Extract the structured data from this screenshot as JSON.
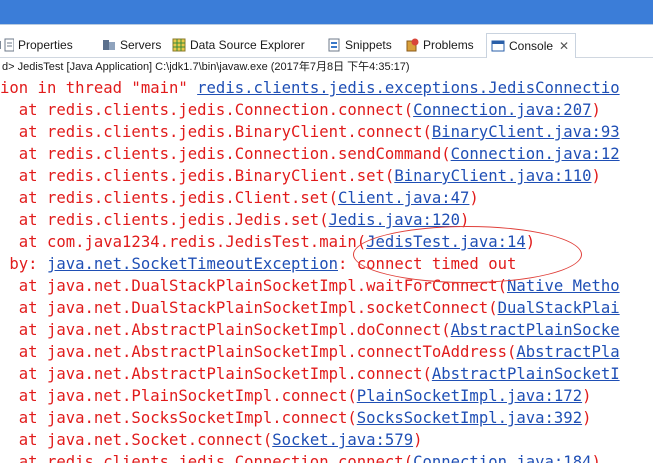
{
  "tabs": [
    {
      "label": "Properties",
      "icon": "properties-icon"
    },
    {
      "label": "Servers",
      "icon": "servers-icon"
    },
    {
      "label": "Data Source Explorer",
      "icon": "data-source-icon"
    },
    {
      "label": "Snippets",
      "icon": "snippets-icon"
    },
    {
      "label": "Problems",
      "icon": "problems-icon"
    },
    {
      "label": "Console",
      "icon": "console-icon",
      "active": true
    }
  ],
  "close_glyph": "✕",
  "process_line": "d> JedisTest [Java Application] C:\\jdk1.7\\bin\\javaw.exe (2017年7月8日 下午4:35:17)",
  "console_lines": [
    {
      "pre": "ion in thread \"main\" ",
      "link": "redis.clients.jedis.exceptions.JedisConnectio",
      "post": ""
    },
    {
      "pre": "  at redis.clients.jedis.Connection.connect(",
      "link": "Connection.java:207",
      "post": ")"
    },
    {
      "pre": "  at redis.clients.jedis.BinaryClient.connect(",
      "link": "BinaryClient.java:93",
      "post": ""
    },
    {
      "pre": "  at redis.clients.jedis.Connection.sendCommand(",
      "link": "Connection.java:12",
      "post": ""
    },
    {
      "pre": "  at redis.clients.jedis.BinaryClient.set(",
      "link": "BinaryClient.java:110",
      "post": ")"
    },
    {
      "pre": "  at redis.clients.jedis.Client.set(",
      "link": "Client.java:47",
      "post": ")"
    },
    {
      "pre": "  at redis.clients.jedis.Jedis.set(",
      "link": "Jedis.java:120",
      "post": ")"
    },
    {
      "pre": "  at com.java1234.redis.JedisTest.main(",
      "link": "JedisTest.java:14",
      "post": ")"
    },
    {
      "pre": " by: ",
      "link": "java.net.SocketTimeoutException",
      "post": ": connect timed out"
    },
    {
      "pre": "  at java.net.DualStackPlainSocketImpl.waitForConnect(",
      "link": "Native Metho",
      "post": ""
    },
    {
      "pre": "  at java.net.DualStackPlainSocketImpl.socketConnect(",
      "link": "DualStackPlai",
      "post": ""
    },
    {
      "pre": "  at java.net.AbstractPlainSocketImpl.doConnect(",
      "link": "AbstractPlainSocke",
      "post": ""
    },
    {
      "pre": "  at java.net.AbstractPlainSocketImpl.connectToAddress(",
      "link": "AbstractPla",
      "post": ""
    },
    {
      "pre": "  at java.net.AbstractPlainSocketImpl.connect(",
      "link": "AbstractPlainSocketI",
      "post": ""
    },
    {
      "pre": "  at java.net.PlainSocketImpl.connect(",
      "link": "PlainSocketImpl.java:172",
      "post": ")"
    },
    {
      "pre": "  at java.net.SocksSocketImpl.connect(",
      "link": "SocksSocketImpl.java:392",
      "post": ")"
    },
    {
      "pre": "  at java.net.Socket.connect(",
      "link": "Socket.java:579",
      "post": ")"
    },
    {
      "pre": "  at redis.clients.jedis.Connection.connect(",
      "link": "Connection.java:184",
      "post": ")"
    }
  ],
  "colors": {
    "error_text": "#e11b1b",
    "link": "#1f4fb5",
    "highlight": "#e0403a"
  }
}
